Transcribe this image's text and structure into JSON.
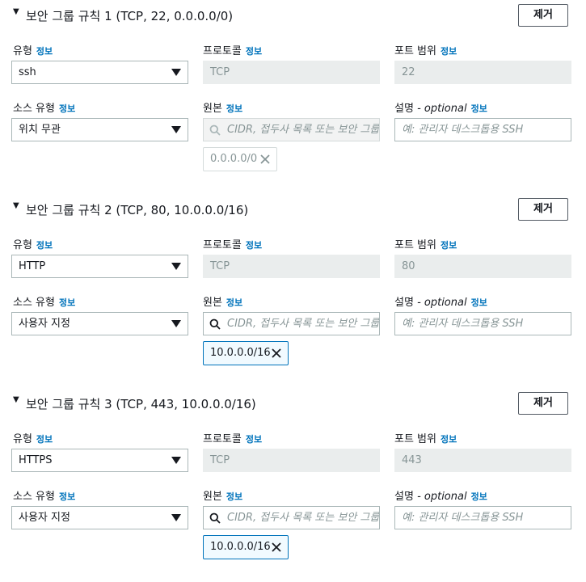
{
  "labels": {
    "type": "유형",
    "protocol": "프로토콜",
    "port_range": "포트 범위",
    "source_type": "소스 유형",
    "source": "원본",
    "description": "설명",
    "description_optional": "- optional",
    "info": "정보",
    "remove": "제거"
  },
  "placeholders": {
    "source_search": "CIDR, 접두사 목록 또는 보안 그룹",
    "description": "예: 관리자 데스크톱용 SSH"
  },
  "rules": [
    {
      "title": "보안 그룹 규칙 1 (TCP, 22, 0.0.0.0/0)",
      "type": "ssh",
      "protocol": "TCP",
      "port_range": "22",
      "source_type": "위치 무관",
      "source_token": "0.0.0.0/0"
    },
    {
      "title": "보안 그룹 규칙 2 (TCP, 80, 10.0.0.0/16)",
      "type": "HTTP",
      "protocol": "TCP",
      "port_range": "80",
      "source_type": "사용자 지정",
      "source_token": "10.0.0.0/16"
    },
    {
      "title": "보안 그룹 규칙 3 (TCP, 443, 10.0.0.0/16)",
      "type": "HTTPS",
      "protocol": "TCP",
      "port_range": "443",
      "source_type": "사용자 지정",
      "source_token": "10.0.0.0/16"
    }
  ],
  "colors": {
    "info_link": "#0073bb",
    "token_border": "#0073bb",
    "disabled_bg": "#eaeded"
  },
  "icons": {
    "collapse": "caret-down-filled-icon",
    "search": "search-icon",
    "dismiss": "close-icon",
    "dropdown": "caret-down-icon"
  }
}
